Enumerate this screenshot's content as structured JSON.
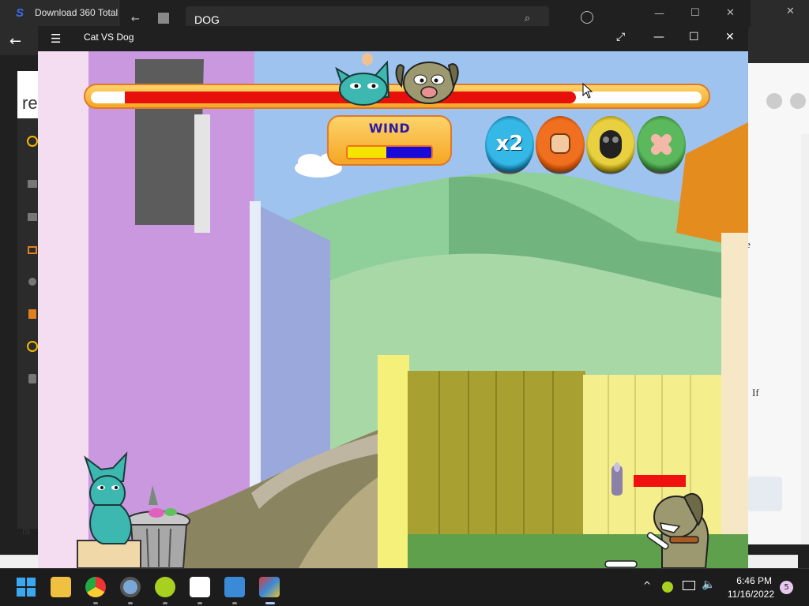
{
  "background": {
    "tab_title": "Download 360 Total",
    "store_search_text": "DOG",
    "left_fragment_1": "re",
    "left_fragment_2": "is",
    "right_fragment_1": "e",
    "right_fragment_2": "If"
  },
  "game_window": {
    "title": "Cat VS Dog"
  },
  "hud": {
    "wind_label": "WIND",
    "health_fraction": 0.79,
    "wind_yellow_fraction": 0.46,
    "powerups": [
      {
        "label": "x2",
        "icon": "double-damage-icon",
        "color": "#35b8e6"
      },
      {
        "label": "",
        "icon": "power-fist-icon",
        "color": "#f07020"
      },
      {
        "label": "",
        "icon": "gas-mask-icon",
        "color": "#d9c020"
      },
      {
        "label": "",
        "icon": "bandage-icon",
        "color": "#5cb85c"
      }
    ]
  },
  "taskbar": {
    "time": "6:46 PM",
    "date": "11/16/2022",
    "notification_count": "5"
  },
  "colors": {
    "hud_frame": "#f5a623",
    "health_red": "#e8100b",
    "wind_yellow": "#f4e400",
    "wind_blue": "#1a0ad8",
    "cat_teal": "#3cb8b0",
    "dog_olive": "#9c9870"
  }
}
